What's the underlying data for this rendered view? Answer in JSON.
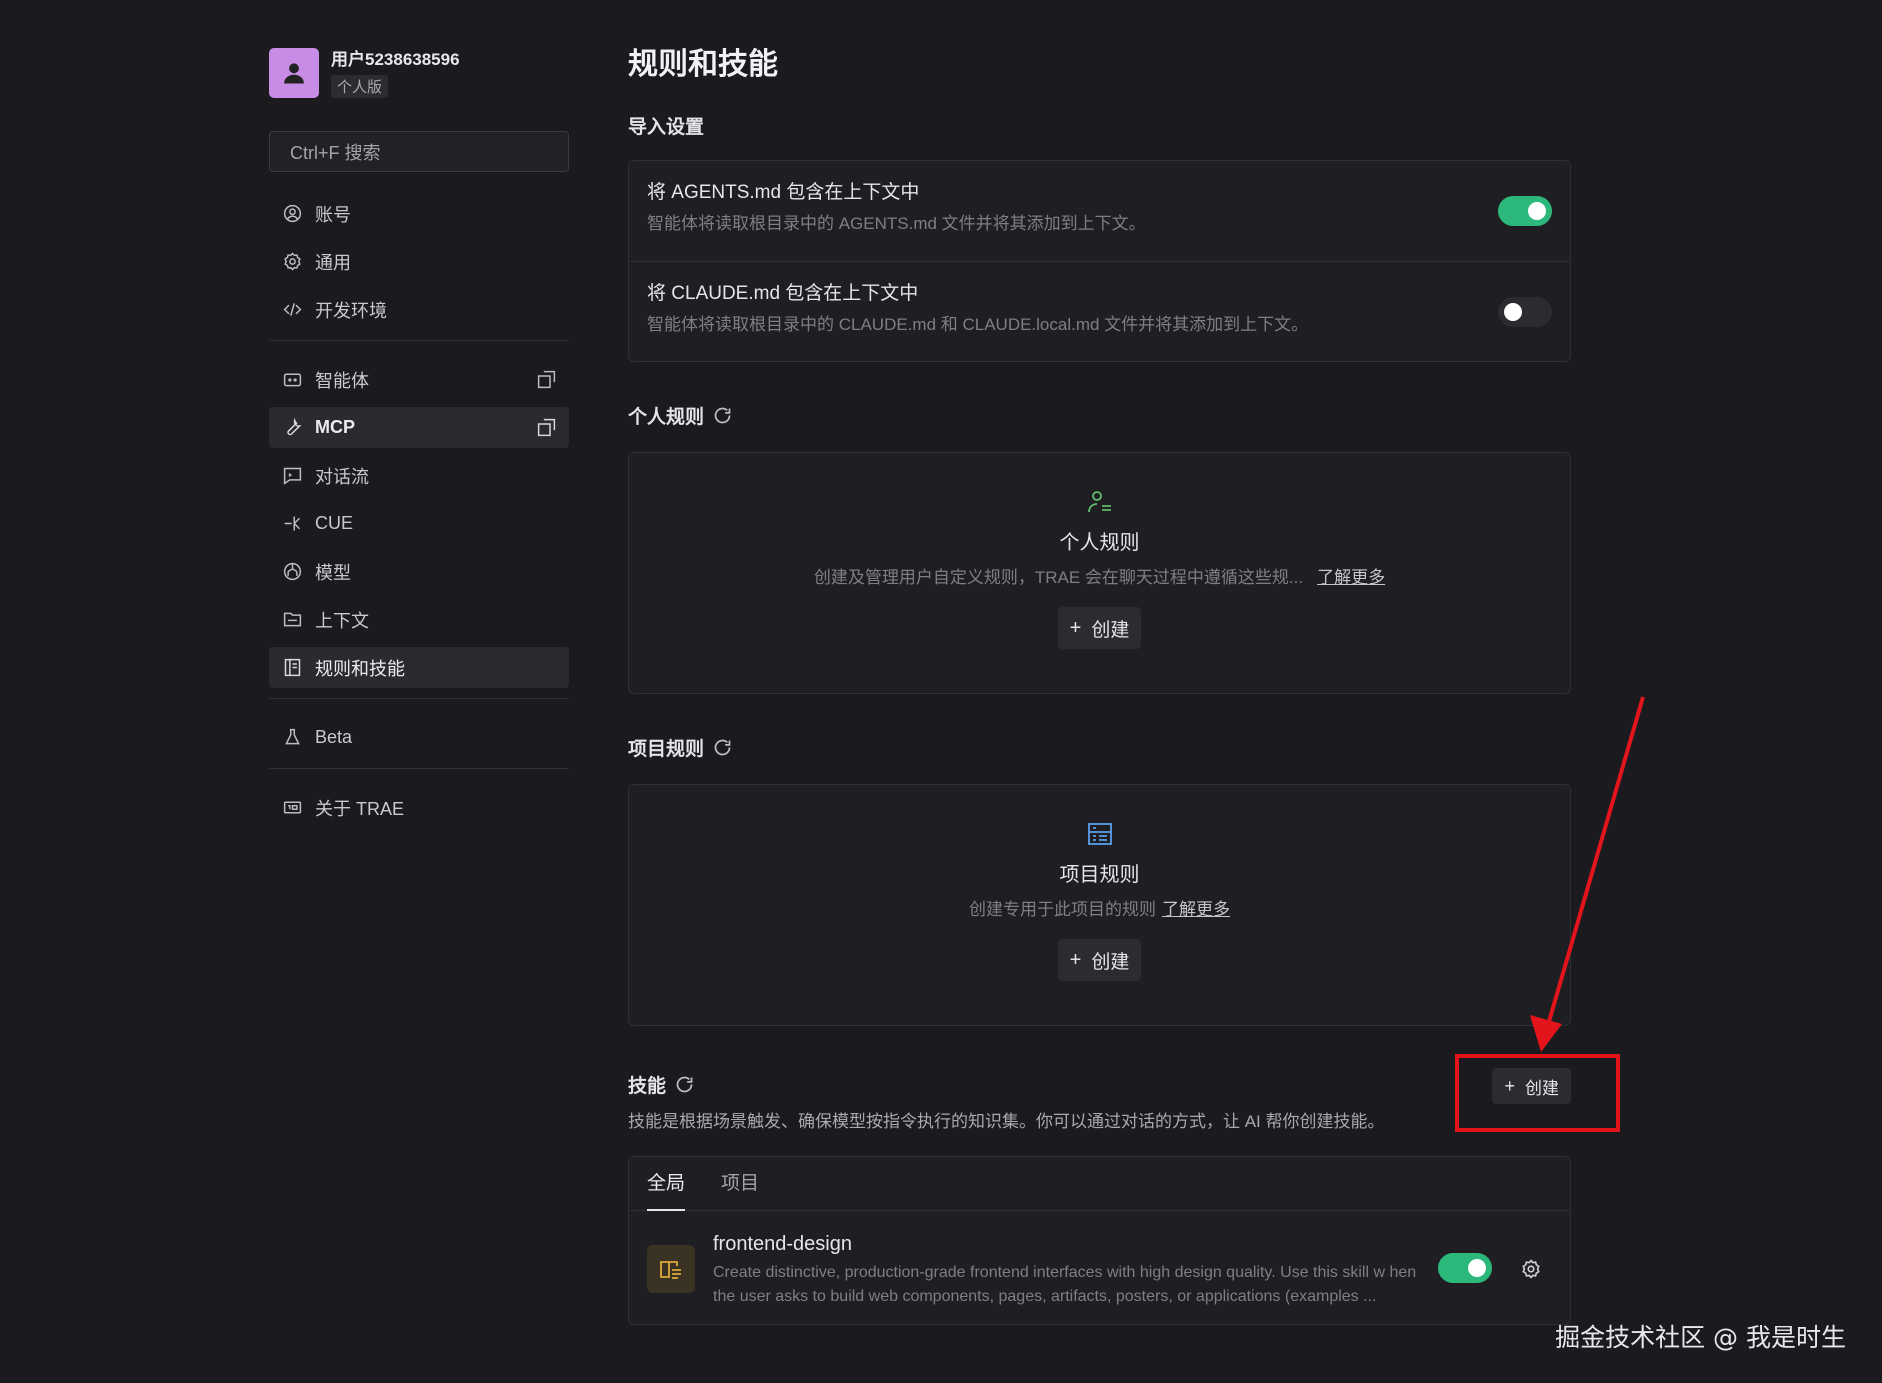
{
  "user": {
    "name": "用户5238638596",
    "plan": "个人版"
  },
  "search": {
    "placeholder": "Ctrl+F 搜索"
  },
  "sidebar": {
    "group1": [
      {
        "label": "账号",
        "icon": "user-circle-icon"
      },
      {
        "label": "通用",
        "icon": "gear-icon"
      },
      {
        "label": "开发环境",
        "icon": "code-icon"
      }
    ],
    "group2": [
      {
        "label": "智能体",
        "icon": "bot-icon",
        "external": true
      },
      {
        "label": "MCP",
        "icon": "wrench-icon",
        "external": true,
        "active": true
      },
      {
        "label": "对话流",
        "icon": "chat-icon"
      },
      {
        "label": "CUE",
        "icon": "cue-icon"
      },
      {
        "label": "模型",
        "icon": "model-icon"
      },
      {
        "label": "上下文",
        "icon": "folder-icon"
      },
      {
        "label": "规则和技能",
        "icon": "rules-icon",
        "active": true
      }
    ],
    "group3": [
      {
        "label": "Beta",
        "icon": "flask-icon"
      }
    ],
    "group4": [
      {
        "label": "关于 TRAE",
        "icon": "info-icon"
      }
    ]
  },
  "main": {
    "title": "规则和技能",
    "import": {
      "title": "导入设置",
      "rows": [
        {
          "title": "将 AGENTS.md 包含在上下文中",
          "desc": "智能体将读取根目录中的 AGENTS.md 文件并将其添加到上下文。",
          "enabled": true
        },
        {
          "title": "将 CLAUDE.md 包含在上下文中",
          "desc": "智能体将读取根目录中的 CLAUDE.md 和 CLAUDE.local.md 文件并将其添加到上下文。",
          "enabled": false
        }
      ]
    },
    "personal_rules": {
      "title": "个人规则",
      "empty_title": "个人规则",
      "desc": "创建及管理用户自定义规则，TRAE 会在聊天过程中遵循这些规...",
      "learn_more": "了解更多",
      "create": "创建"
    },
    "project_rules": {
      "title": "项目规则",
      "empty_title": "项目规则",
      "desc": "创建专用于此项目的规则",
      "learn_more": "了解更多",
      "create": "创建"
    },
    "skills": {
      "title": "技能",
      "create": "创建",
      "desc": "技能是根据场景触发、确保模型按指令执行的知识集。你可以通过对话的方式，让 AI 帮你创建技能。",
      "tabs": [
        "全局",
        "项目"
      ],
      "active_tab": 0,
      "items": [
        {
          "name": "frontend-design",
          "desc": "Create distinctive, production-grade frontend interfaces with high design quality. Use this skill w hen the user asks to build web components, pages, artifacts, posters, or applications (examples ...",
          "enabled": true
        }
      ]
    }
  },
  "colors": {
    "accent_green": "#2cb87a",
    "annotation_red": "#e3141c",
    "avatar": "#c88be6"
  },
  "watermark": "掘金技术社区 @ 我是时生"
}
